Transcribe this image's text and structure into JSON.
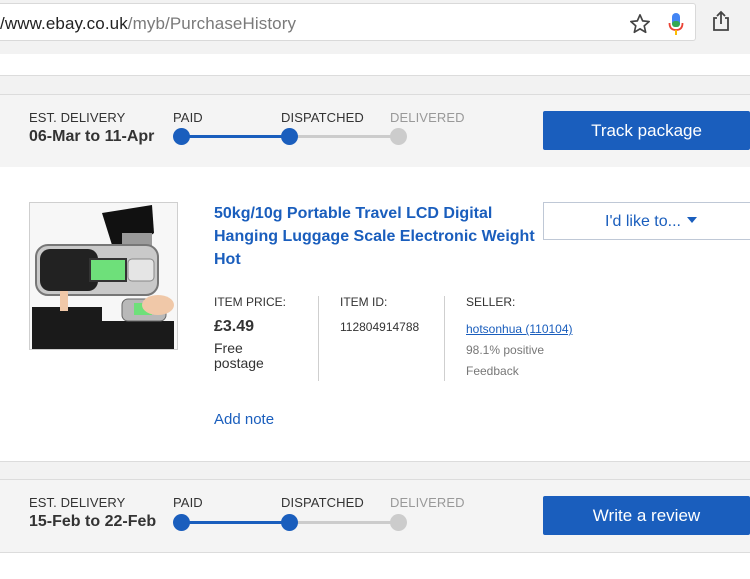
{
  "browser": {
    "url_host": "/www.ebay.co.uk",
    "url_path": "/myb/PurchaseHistory",
    "icons": [
      "star-icon",
      "microphone-icon",
      "share-icon"
    ]
  },
  "orders": [
    {
      "est_delivery_label": "EST. DELIVERY",
      "est_delivery_dates": "06-Mar to 11-Apr",
      "steps": [
        "PAID",
        "DISPATCHED",
        "DELIVERED"
      ],
      "progress_completed_steps": 2,
      "action_label": "Track package"
    },
    {
      "est_delivery_label": "EST. DELIVERY",
      "est_delivery_dates": "15-Feb to 22-Feb",
      "steps": [
        "PAID",
        "DISPATCHED",
        "DELIVERED"
      ],
      "progress_completed_steps": 2,
      "action_label": "Write a review"
    }
  ],
  "item": {
    "title": "50kg/10g Portable Travel LCD Digital Hanging Luggage Scale Electronic Weight Hot",
    "actions_label": "I'd like to...",
    "price_label": "ITEM PRICE:",
    "price": "£3.49",
    "postage_line1": "Free",
    "postage_line2": "postage",
    "item_id_label": "ITEM ID:",
    "item_id": "112804914788",
    "seller_label": "SELLER:",
    "seller_name": "hotsonhua (110104)",
    "seller_rating": "98.1% positive",
    "seller_feedback": "Feedback",
    "add_note": "Add note"
  },
  "colors": {
    "accent": "#1a5ebd",
    "progress_done": "#1a5ebd",
    "progress_pending": "#cccccc",
    "panel_bg": "#f4f4f4"
  }
}
